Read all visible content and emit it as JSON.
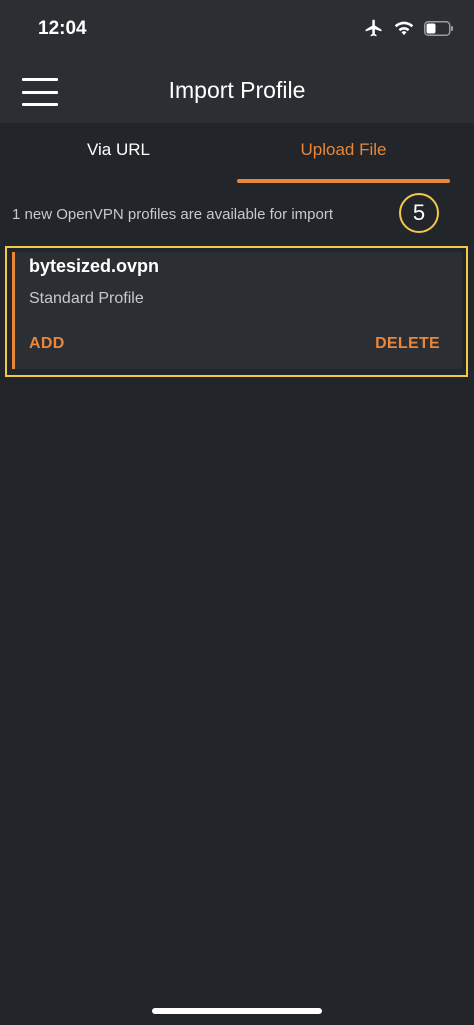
{
  "status_bar": {
    "time": "12:04",
    "icons": [
      "airplane-icon",
      "wifi-icon",
      "battery-icon"
    ]
  },
  "header": {
    "title": "Import Profile",
    "menu_icon": "hamburger-menu-icon"
  },
  "tabs": [
    {
      "label": "Via URL",
      "active": false
    },
    {
      "label": "Upload File",
      "active": true
    }
  ],
  "import_info": {
    "message": "1 new OpenVPN profiles are available for import",
    "step_number": "5"
  },
  "profiles": [
    {
      "name": "bytesized.ovpn",
      "type": "Standard Profile",
      "add_label": "ADD",
      "delete_label": "DELETE"
    }
  ],
  "colors": {
    "accent": "#e8863a",
    "highlight": "#f0c84a",
    "background": "#22262a",
    "header": "#2b2f33"
  }
}
